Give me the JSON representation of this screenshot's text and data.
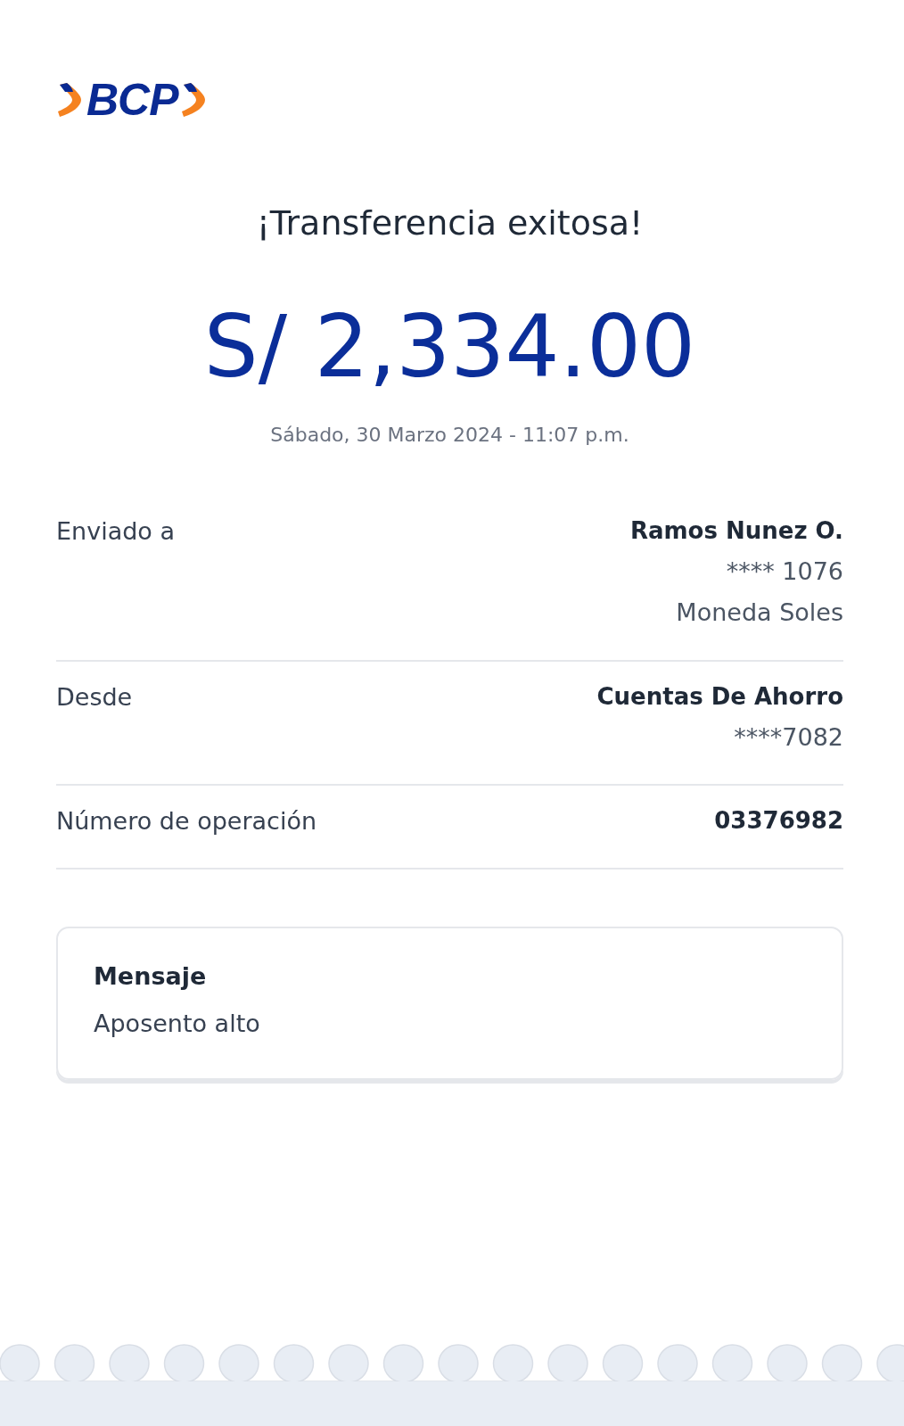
{
  "logo": {
    "text": "BCP"
  },
  "title": "¡Transferencia exitosa!",
  "amount": "S/ 2,334.00",
  "date": "Sábado, 30 Marzo 2024 - 11:07 p.m.",
  "details": [
    {
      "label": "Enviado a",
      "lines": [
        "Ramos Nunez O.",
        "**** 1076",
        "Moneda Soles"
      ]
    },
    {
      "label": "Desde",
      "lines": [
        "Cuentas De Ahorro",
        "****7082"
      ]
    },
    {
      "label": "Número de operación",
      "lines": [
        "03376982"
      ]
    }
  ],
  "message": {
    "heading": "Mensaje",
    "text": "Aposento alto"
  }
}
